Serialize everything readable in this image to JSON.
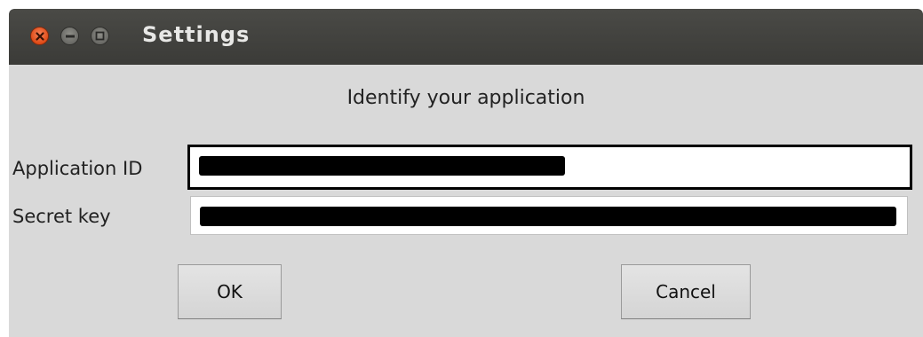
{
  "window": {
    "title": "Settings"
  },
  "form": {
    "heading": "Identify your application",
    "application_id_label": "Application ID",
    "secret_key_label": "Secret key",
    "application_id_value_state": "redacted",
    "secret_key_value_state": "redacted"
  },
  "buttons": {
    "ok_label": "OK",
    "cancel_label": "Cancel"
  },
  "colors": {
    "titlebar": "#3f3f3c",
    "window_background": "#d9d9d9",
    "close_button": "#e8571f",
    "redaction": "#000000"
  },
  "icons": {
    "close": "close-icon",
    "minimize": "minimize-icon",
    "maximize": "maximize-icon"
  }
}
